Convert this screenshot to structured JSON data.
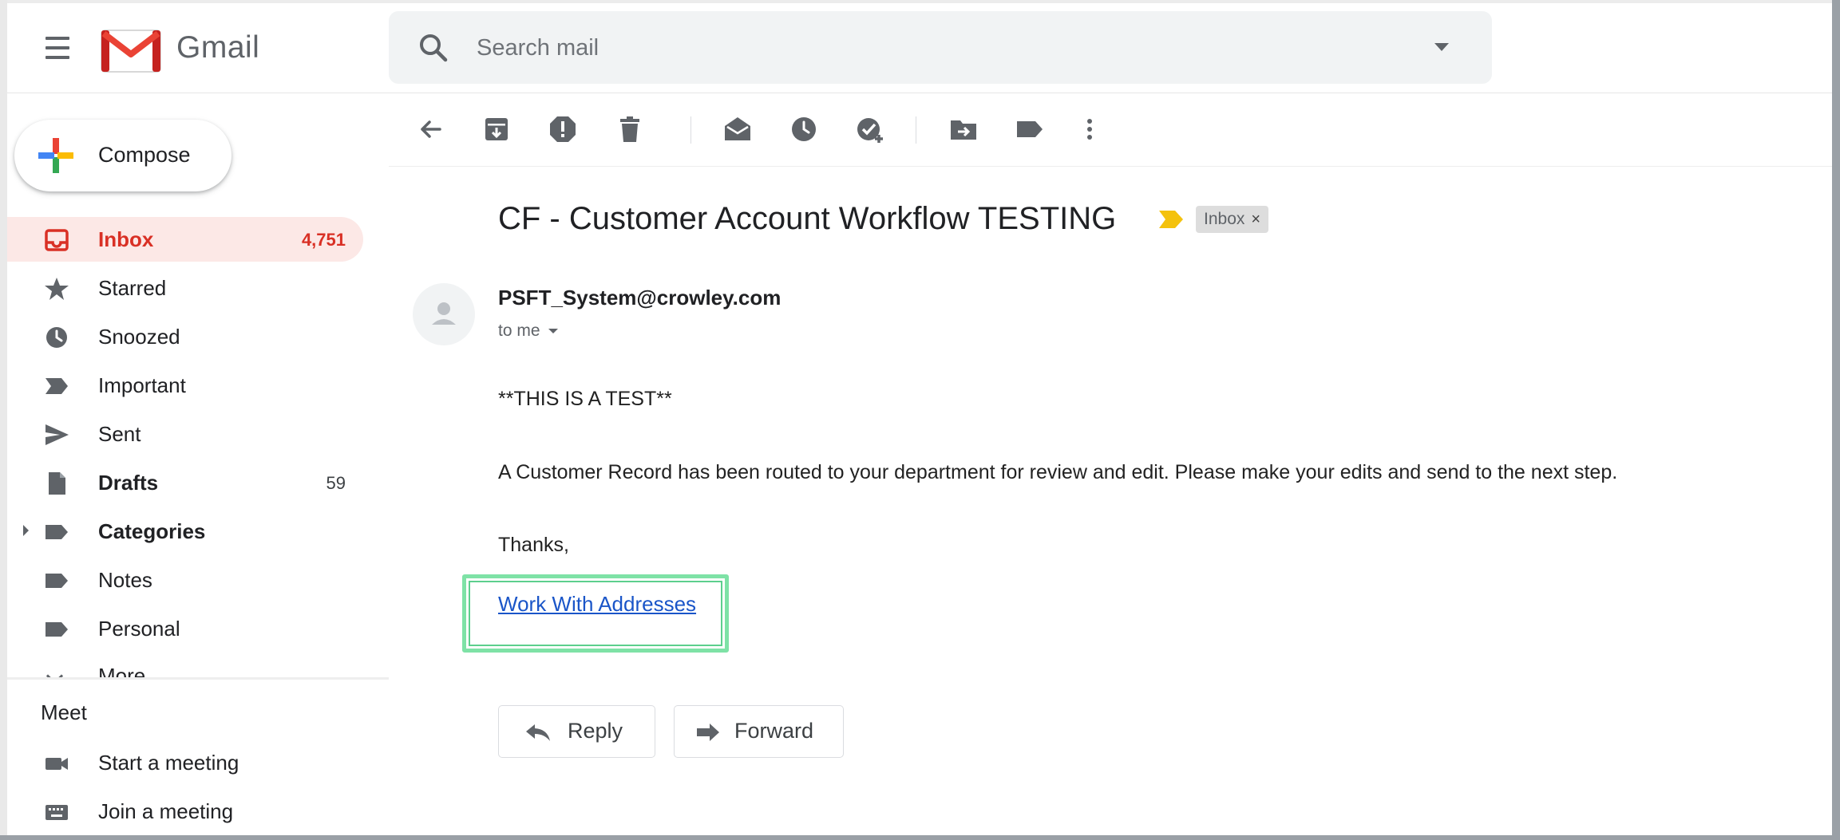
{
  "header": {
    "brand": "Gmail",
    "search": {
      "placeholder": "Search mail",
      "value": ""
    }
  },
  "sidebar": {
    "compose_label": "Compose",
    "items": [
      {
        "label": "Inbox",
        "count": "4,751",
        "icon": "inbox-icon",
        "active": true
      },
      {
        "label": "Starred",
        "count": "",
        "icon": "star-icon"
      },
      {
        "label": "Snoozed",
        "count": "",
        "icon": "clock-icon"
      },
      {
        "label": "Important",
        "count": "",
        "icon": "important-icon"
      },
      {
        "label": "Sent",
        "count": "",
        "icon": "send-icon"
      },
      {
        "label": "Drafts",
        "count": "59",
        "icon": "draft-icon"
      },
      {
        "label": "Categories",
        "count": "",
        "icon": "label-icon"
      },
      {
        "label": "Notes",
        "count": "",
        "icon": "label-icon"
      },
      {
        "label": "Personal",
        "count": "",
        "icon": "label-icon"
      },
      {
        "label": "More",
        "count": "",
        "icon": "chevron-down-icon"
      }
    ],
    "meet": {
      "title": "Meet",
      "start": "Start a meeting",
      "join": "Join a meeting"
    }
  },
  "toolbar": {
    "actions": [
      "back",
      "archive",
      "report-spam",
      "delete",
      "mark-unread",
      "snooze",
      "add-to-tasks",
      "move-to",
      "labels",
      "more"
    ]
  },
  "message": {
    "subject": "CF - Customer Account Workflow TESTING",
    "label_chip": "Inbox",
    "label_close": "×",
    "sender": "PSFT_System@crowley.com",
    "recipient": "to me",
    "body": {
      "line1": "**THIS IS A TEST**",
      "line2": "A Customer Record has been routed to your department for review and edit. Please make your edits and send to the next step.",
      "line3": "Thanks,",
      "link": "Work With Addresses"
    },
    "reply_label": "Reply",
    "forward_label": "Forward"
  },
  "colors": {
    "active_red": "#d93025",
    "active_bg": "#fce8e6",
    "link_blue": "#1a55c8",
    "highlight_green": "#7ee2a6",
    "important_yellow": "#f4c20d"
  }
}
